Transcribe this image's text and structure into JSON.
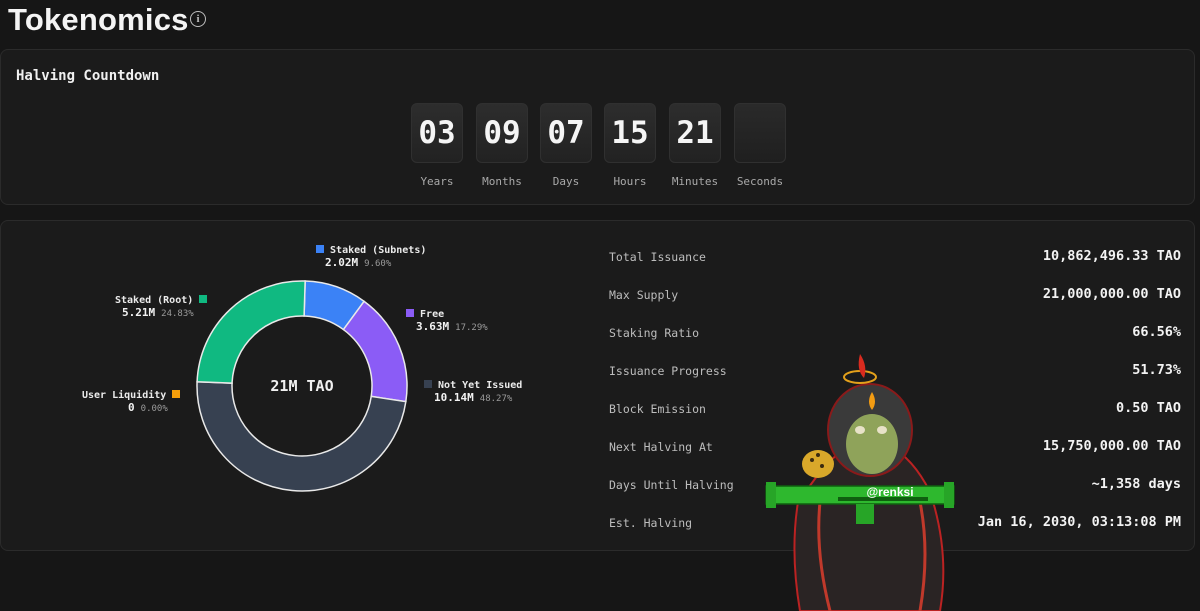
{
  "header": {
    "title": "Tokenomics",
    "info_icon": "info-icon"
  },
  "countdown": {
    "title": "Halving Countdown",
    "units": [
      {
        "value": "03",
        "label": "Years"
      },
      {
        "value": "09",
        "label": "Months"
      },
      {
        "value": "07",
        "label": "Days"
      },
      {
        "value": "15",
        "label": "Hours"
      },
      {
        "value": "21",
        "label": "Minutes"
      },
      {
        "value": "",
        "label": "Seconds"
      }
    ]
  },
  "chart_data": {
    "type": "pie",
    "center_label": "21M TAO",
    "slices": [
      {
        "name": "Staked (Subnets)",
        "amount": "2.02M",
        "percent": "9.60%",
        "value": 9.6,
        "color": "#3b82f6"
      },
      {
        "name": "Free",
        "amount": "3.63M",
        "percent": "17.29%",
        "value": 17.29,
        "color": "#8b5cf6"
      },
      {
        "name": "Not Yet Issued",
        "amount": "10.14M",
        "percent": "48.27%",
        "value": 48.27,
        "color": "#374151"
      },
      {
        "name": "User Liquidity",
        "amount": "0",
        "percent": "0.00%",
        "value": 0.0,
        "color": "#f59e0b"
      },
      {
        "name": "Staked (Root)",
        "amount": "5.21M",
        "percent": "24.83%",
        "value": 24.83,
        "color": "#10b981"
      }
    ]
  },
  "stats": [
    {
      "label": "Total Issuance",
      "value": "10,862,496.33 TAO"
    },
    {
      "label": "Max Supply",
      "value": "21,000,000.00 TAO"
    },
    {
      "label": "Staking Ratio",
      "value": "66.56%"
    },
    {
      "label": "Issuance Progress",
      "value": "51.73%"
    },
    {
      "label": "Block Emission",
      "value": "0.50 TAO"
    },
    {
      "label": "Next Halving At",
      "value": "15,750,000.00 TAO"
    },
    {
      "label": "Days Until Halving",
      "value": "~1,358 days"
    },
    {
      "label": "Est. Halving",
      "value": "Jan 16, 2030, 03:13:08 PM"
    }
  ],
  "watermark": {
    "handle": "@renksi"
  }
}
